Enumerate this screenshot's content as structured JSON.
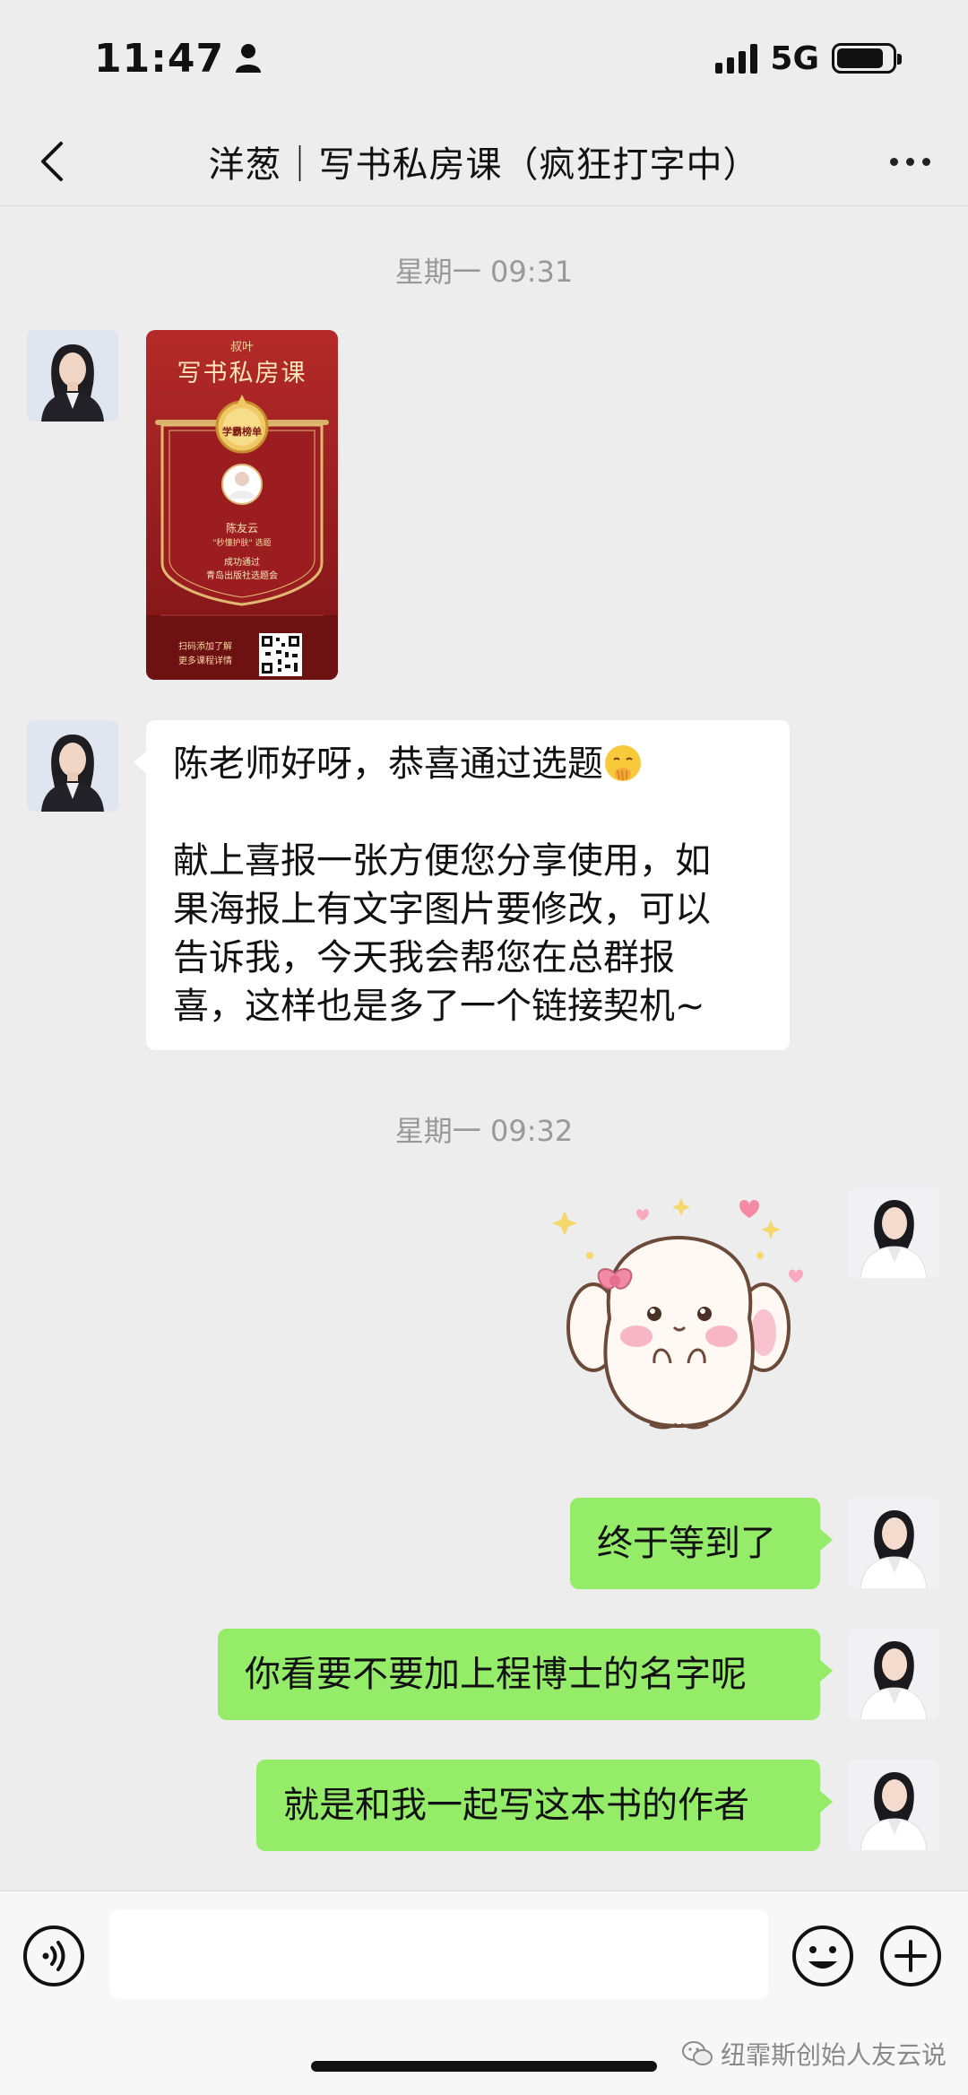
{
  "status_bar": {
    "time": "11:47",
    "network": "5G",
    "battery_level": 0.85
  },
  "header": {
    "title": "洋葱｜写书私房课（疯狂打字中）"
  },
  "messages": [
    {
      "type": "timestamp",
      "text": "星期一 09:31"
    },
    {
      "type": "image",
      "side": "left",
      "poster": {
        "brand": "叔叶",
        "title": "写书私房课",
        "badge": "学霸榜单",
        "name": "陈友云",
        "subject": "\"秒懂护肤\" 选题",
        "pass_line1": "成功通过",
        "pass_line2": "青岛出版社选题会",
        "scan_line1": "扫码添加了解",
        "scan_line2": "更多课程详情"
      }
    },
    {
      "type": "text",
      "side": "left",
      "lines": [
        "陈老师好呀，恭喜通过选题",
        "",
        "献上喜报一张方便您分享使用，如",
        "果海报上有文字图片要修改，可以",
        "告诉我，今天我会帮您在总群报",
        "喜，这样也是多了一个链接契机~"
      ]
    },
    {
      "type": "timestamp",
      "text": "星期一 09:32"
    },
    {
      "type": "sticker",
      "side": "right",
      "icon": "bunny-sticker"
    },
    {
      "type": "text",
      "side": "right",
      "text": "终于等到了"
    },
    {
      "type": "text",
      "side": "right",
      "text": "你看要不要加上程博士的名字呢"
    },
    {
      "type": "text",
      "side": "right",
      "text": "就是和我一起写这本书的作者"
    }
  ],
  "input_bar": {
    "placeholder": ""
  },
  "watermark": "纽霏斯创始人友云说",
  "colors": {
    "background": "#ededed",
    "bubble_green": "#95ec69",
    "bubble_white": "#ffffff",
    "poster_red": "#b52a2a"
  }
}
